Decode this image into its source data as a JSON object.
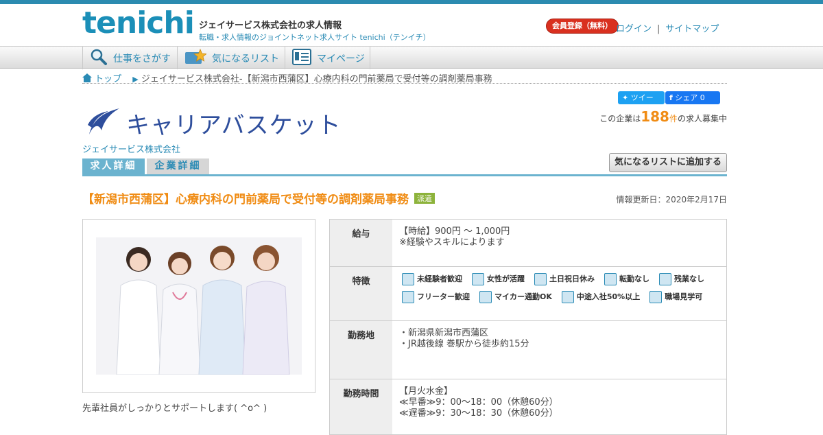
{
  "site": {
    "logo": "tenichi",
    "title": "ジェイサービス株式会社の求人情報",
    "subtitle": "転職・求人情報のジョイントネット求人サイト tenichi（テンイチ）"
  },
  "header": {
    "register": "会員登録（無料）",
    "login": "ログイン",
    "separator": "|",
    "sitemap": "サイトマップ"
  },
  "nav": {
    "items": [
      {
        "label": "仕事をさがす",
        "icon": "magnifier-icon"
      },
      {
        "label": "気になるリスト",
        "icon": "star-folder-icon"
      },
      {
        "label": "マイページ",
        "icon": "mypage-icon"
      }
    ]
  },
  "breadcrumb": {
    "home": "トップ",
    "current": "ジェイサービス株式会社-【新潟市西蒲区】心療内科の門前薬局で受付等の調剤薬局事務"
  },
  "social": {
    "tweet": "ツイート",
    "share": "シェア 0"
  },
  "company": {
    "brand": "キャリアバスケット",
    "name": "ジェイサービス株式会社",
    "count_prefix": "この企業は",
    "count": "188",
    "count_unit": "件",
    "count_suffix": "の求人募集中"
  },
  "tabs": {
    "job": "求人詳細",
    "company": "企業詳細"
  },
  "fav_button": "気になるリストに追加する",
  "job": {
    "title": "【新潟市西蒲区】心療内科の門前薬局で受付等の調剤薬局事務",
    "badge": "派遣",
    "updated": "情報更新日：2020年2月17日",
    "caption": "先輩社員がしっかりとサポートします( ^o^ )"
  },
  "spec": {
    "salary_label": "給与",
    "salary_1": "【時給】900円 ～ 1,000円",
    "salary_2": "※経験やスキルによります",
    "features_label": "特徴",
    "features": [
      "未経験者歓迎",
      "女性が活躍",
      "土日祝日休み",
      "転勤なし",
      "残業なし",
      "フリーター歓迎",
      "マイカー通勤OK",
      "中途入社50%以上",
      "職場見学可"
    ],
    "location_label": "勤務地",
    "location_1": "・新潟県新潟市西蒲区",
    "location_2": "・JR越後線 巻駅から徒歩約15分",
    "hours_label": "勤務時間",
    "hours_1": "【月火水金】",
    "hours_2": "≪早番≫9：00～18：00（休憩60分）",
    "hours_3": "≪遅番≫9：30～18：30（休憩60分）"
  },
  "colors": {
    "accent": "#2a8bb5",
    "orange": "#f08c14",
    "register": "#d9301f"
  }
}
